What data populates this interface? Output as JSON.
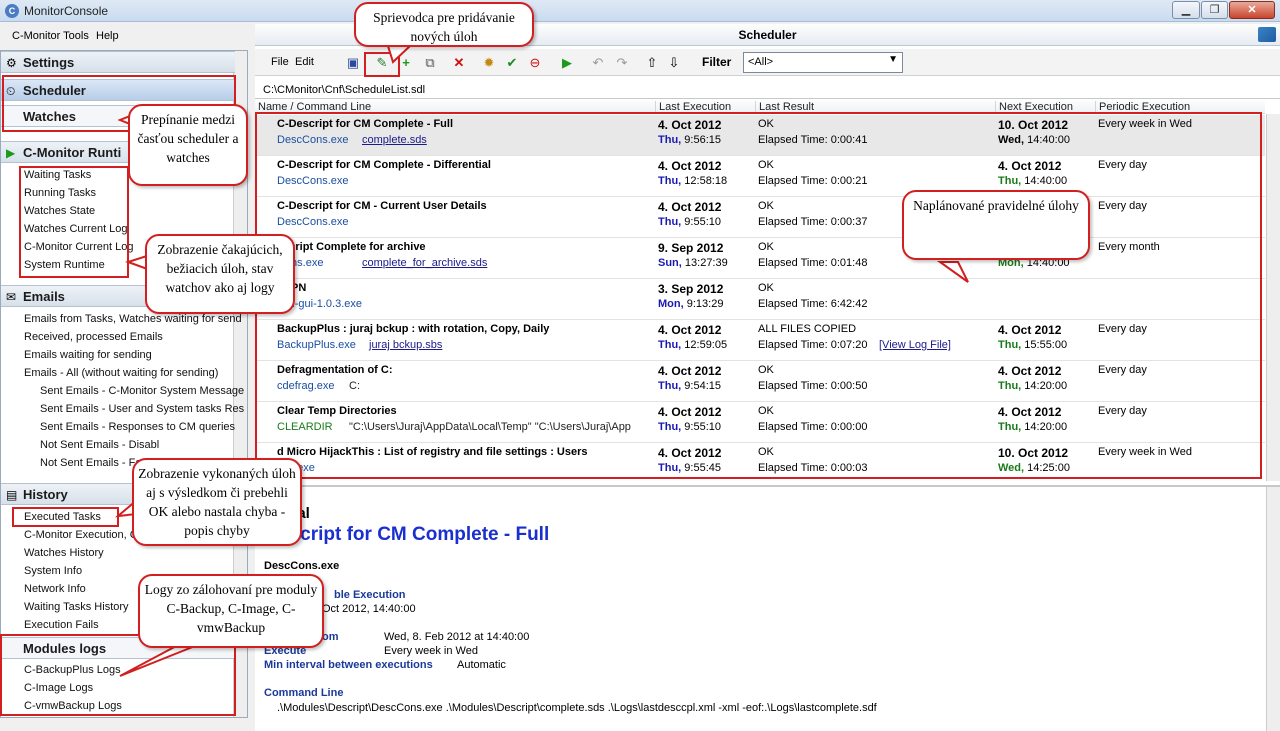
{
  "window": {
    "title": "MonitorConsole"
  },
  "menu": {
    "tools": "C-Monitor Tools",
    "help": "Help"
  },
  "left": {
    "settings": "Settings",
    "scheduler": "Scheduler",
    "watches": "Watches",
    "runtime": "C-Monitor Runti",
    "runtime_items": [
      "Waiting Tasks",
      "Running Tasks",
      "Watches State",
      "Watches Current Log",
      "C-Monitor Current Log",
      "System Runtime"
    ],
    "emails": "Emails",
    "email_items": [
      "Emails from Tasks, Watches waiting for send",
      "Received, processed Emails",
      "Emails waiting for sending",
      "Emails - All (without waiting for sending)"
    ],
    "email_subitems": [
      "Sent Emails - C-Monitor System Message",
      "Sent Emails - User and System tasks Res",
      "Sent Emails - Responses to CM queries",
      "Not Sent Emails - Disabl",
      "Not Sent Emails - Fa"
    ],
    "history": "History",
    "history_items": [
      "Executed Tasks",
      "C-Monitor Execution, C",
      "Watches History",
      "System Info",
      "Network Info",
      "Waiting Tasks History",
      "Execution Fails"
    ],
    "modules": "Modules logs",
    "module_items": [
      "C-BackupPlus Logs",
      "C-Image Logs",
      "C-vmwBackup Logs"
    ]
  },
  "right": {
    "title": "Scheduler",
    "file": "File",
    "edit": "Edit",
    "filter_label": "Filter",
    "filter_value": "<All>",
    "path": "C:\\CMonitor\\Cnf\\ScheduleList.sdl",
    "columns": [
      "Name / Command Line",
      "Last Execution",
      "Last Result",
      "Next Execution",
      "Periodic Execution"
    ],
    "rows": [
      {
        "name": "C-Descript for CM Complete - Full",
        "exe": "DescCons.exe",
        "arg": "complete.sds",
        "last": "4. Oct 2012",
        "last_day": "Thu,",
        "last_time": "9:56:15",
        "result": "OK",
        "elapsed": "Elapsed Time: 0:00:41",
        "next": "10. Oct 2012",
        "next_day": "Wed,",
        "next_time": "14:40:00",
        "period": "Every week in Wed"
      },
      {
        "name": "C-Descript for CM Complete - Differential",
        "exe": "DescCons.exe",
        "arg": "",
        "last": "4. Oct 2012",
        "last_day": "Thu,",
        "last_time": "12:58:18",
        "result": "OK",
        "elapsed": "Elapsed Time: 0:00:21",
        "next": "4. Oct 2012",
        "next_day": "Thu,",
        "next_time": "14:40:00",
        "period": "Every day"
      },
      {
        "name": "C-Descript for CM - Current User Details",
        "exe": "DescCons.exe",
        "arg": "",
        "last": "4. Oct 2012",
        "last_day": "Thu,",
        "last_time": "9:55:10",
        "result": "OK",
        "elapsed": "Elapsed Time: 0:00:37",
        "next": "",
        "next_day": "",
        "next_time": "",
        "period": "Every day"
      },
      {
        "name": "escript Complete for archive",
        "exe": "Cons.exe",
        "arg": "complete_for_archive.sds",
        "last": "9. Sep 2012",
        "last_day": "Sun,",
        "last_time": "13:27:39",
        "result": "OK",
        "elapsed": "Elapsed Time: 0:01:48",
        "next": "",
        "next_day": "Mon,",
        "next_time": "14:40:00",
        "period": "Every month"
      },
      {
        "name": "nVPN",
        "exe": "vpn-gui-1.0.3.exe",
        "arg": "",
        "last": "3. Sep 2012",
        "last_day": "Mon,",
        "last_time": "9:13:29",
        "result": "OK",
        "elapsed": "Elapsed Time: 6:42:42",
        "next": "",
        "next_day": "",
        "next_time": "",
        "period": ""
      },
      {
        "name": "BackupPlus : juraj bckup : with rotation, Copy, Daily",
        "exe": "BackupPlus.exe",
        "arg": "juraj bckup.sbs",
        "last": "4. Oct 2012",
        "last_day": "Thu,",
        "last_time": "12:59:05",
        "result": "ALL FILES COPIED",
        "elapsed": "Elapsed Time: 0:07:20",
        "log": "[View Log File]",
        "next": "4. Oct 2012",
        "next_day": "Thu,",
        "next_time": "15:55:00",
        "period": "Every day"
      },
      {
        "name": "Defragmentation of C:",
        "exe": "cdefrag.exe",
        "arg": "C:",
        "last": "4. Oct 2012",
        "last_day": "Thu,",
        "last_time": "9:54:15",
        "result": "OK",
        "elapsed": "Elapsed Time: 0:00:50",
        "next": "4. Oct 2012",
        "next_day": "Thu,",
        "next_time": "14:20:00",
        "period": "Every day"
      },
      {
        "name": "Clear Temp Directories",
        "exe": "CLEARDIR",
        "arg": "\"C:\\Users\\Juraj\\AppData\\Local\\Temp\" \"C:\\Users\\Juraj\\App",
        "last": "4. Oct 2012",
        "last_day": "Thu,",
        "last_time": "9:55:10",
        "result": "OK",
        "elapsed": "Elapsed Time: 0:00:00",
        "next": "4. Oct 2012",
        "next_day": "Thu,",
        "next_time": "14:20:00",
        "period": "Every day"
      },
      {
        "name": "d Micro HijackThis : List of registry and file settings : Users",
        "exe": "xec.exe",
        "arg": "",
        "last": "4. Oct 2012",
        "last_day": "Thu,",
        "last_time": "9:55:45",
        "result": "OK",
        "elapsed": "Elapsed Time: 0:00:03",
        "next": "10. Oct 2012",
        "next_day": "Wed,",
        "next_time": "14:25:00",
        "period": "Every week in Wed"
      }
    ],
    "detail": {
      "kind": "ntial",
      "title": "escript for CM Complete - Full",
      "exe": "DescCons.exe",
      "sched_label": "ble Execution",
      "sched_value": "Oct 2012, 14:40:00",
      "from_label": "om",
      "from_value": "Wed, 8. Feb 2012 at 14:40:00",
      "execute_label": "Execute",
      "execute_value": "Every week in Wed",
      "min_label": "Min interval between executions",
      "min_value": "Automatic",
      "cmd_label": "Command Line",
      "cmd_value": ".\\Modules\\Descript\\DescCons.exe .\\Modules\\Descript\\complete.sds .\\Logs\\lastdesccpl.xml -xml -eof:.\\Logs\\lastcomplete.sdf"
    }
  },
  "callouts": {
    "wizard": "Sprievodca pre pridávanie nových úloh",
    "switch": "Prepínanie medzi časťou scheduler a watches",
    "waiting": "Zobrazenie čakajúcich, bežiacich úloh, stav watchov ako aj logy",
    "scheduled": "Naplánované pravidelné úlohy",
    "executed": "Zobrazenie vykonaných úloh aj s výsledkom či prebehli OK alebo nastala chyba - popis chyby",
    "logs": "Logy zo zálohovaní pre moduly C-Backup, C-Image, C-vmwBackup"
  }
}
